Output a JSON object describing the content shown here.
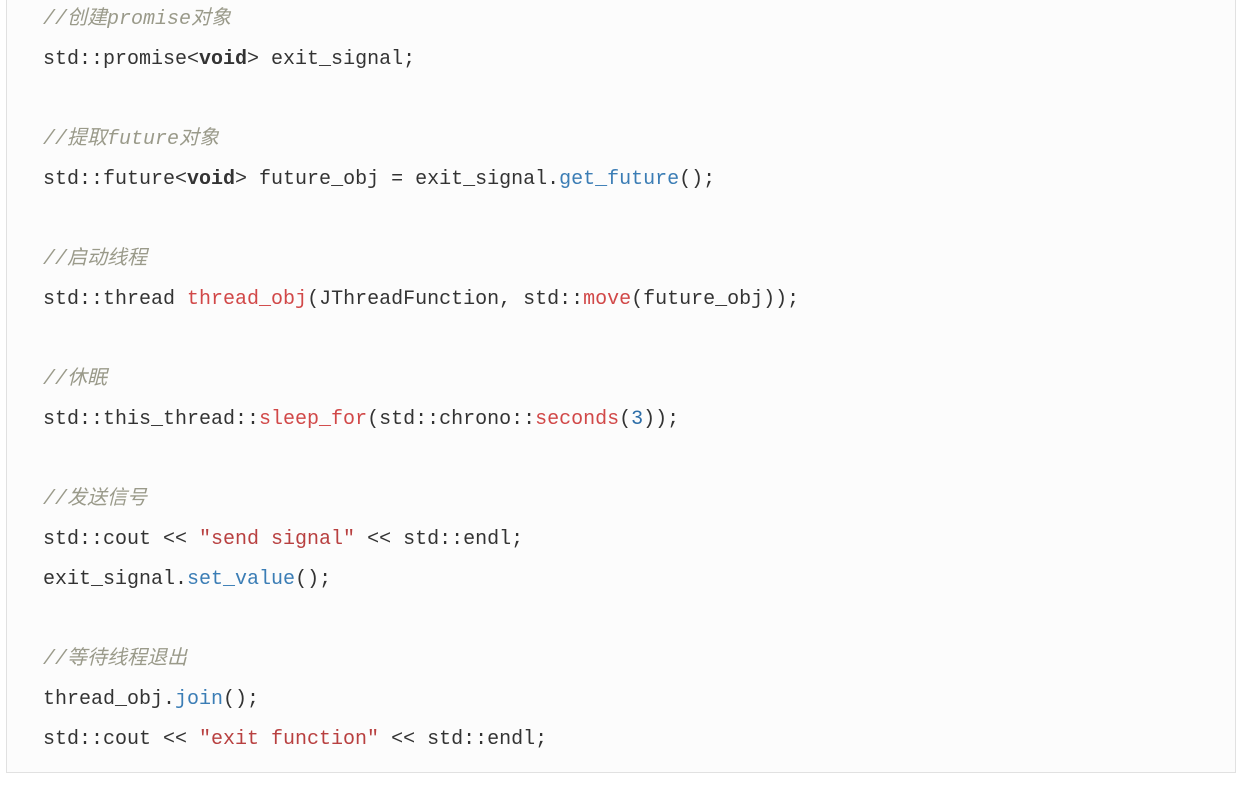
{
  "code": {
    "l1_comment": "//创建promise对象",
    "l2_a": "std::promise<",
    "l2_void": "void",
    "l2_b": "> exit_signal;",
    "l3_comment": "//提取future对象",
    "l4_a": "std::future<",
    "l4_void": "void",
    "l4_b": "> future_obj = exit_signal.",
    "l4_fn": "get_future",
    "l4_c": "();",
    "l5_comment": "//启动线程",
    "l6_a": "std::thread ",
    "l6_fn1": "thread_obj",
    "l6_b": "(JThreadFunction, std::",
    "l6_fn2": "move",
    "l6_c": "(future_obj));",
    "l7_comment": "//休眠",
    "l8_a": "std::this_thread::",
    "l8_fn1": "sleep_for",
    "l8_b": "(std::chrono::",
    "l8_fn2": "seconds",
    "l8_c": "(",
    "l8_num": "3",
    "l8_d": "));",
    "l9_comment": "//发送信号",
    "l10_a": "std::cout << ",
    "l10_str": "\"send signal\"",
    "l10_b": " << std::endl;",
    "l11_a": "exit_signal.",
    "l11_fn": "set_value",
    "l11_b": "();",
    "l12_comment": "//等待线程退出",
    "l13_a": "thread_obj.",
    "l13_fn": "join",
    "l13_b": "();",
    "l14_a": "std::cout << ",
    "l14_str": "\"exit function\"",
    "l14_b": " << std::endl;"
  }
}
